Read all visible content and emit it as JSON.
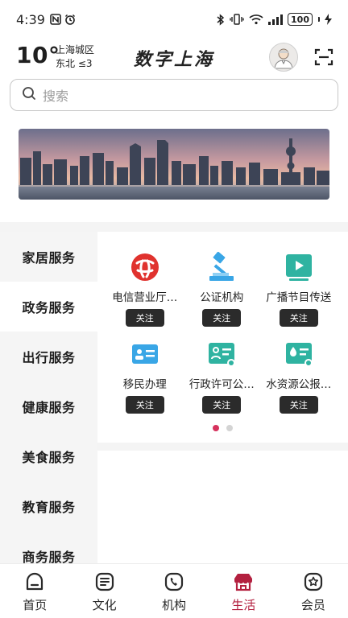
{
  "status_bar": {
    "time": "4:39",
    "battery": "100"
  },
  "header": {
    "temperature": "10°",
    "district": "上海城区",
    "wind": "东北  ≤3",
    "title": "数字上海"
  },
  "search": {
    "placeholder": "搜索"
  },
  "sidebar": {
    "items": [
      {
        "label": "家居服务"
      },
      {
        "label": "政务服务"
      },
      {
        "label": "出行服务"
      },
      {
        "label": "健康服务"
      },
      {
        "label": "美食服务"
      },
      {
        "label": "教育服务"
      },
      {
        "label": "商务服务"
      }
    ],
    "active_index": 1
  },
  "services": [
    {
      "label": "电信营业厅…",
      "icon": "telecom-logo-icon",
      "button": "关注"
    },
    {
      "label": "公证机构",
      "icon": "gavel-icon",
      "button": "关注"
    },
    {
      "label": "广播节目传送",
      "icon": "video-play-icon",
      "button": "关注"
    },
    {
      "label": "移民办理",
      "icon": "id-card-icon",
      "button": "关注"
    },
    {
      "label": "行政许可公…",
      "icon": "license-icon",
      "button": "关注"
    },
    {
      "label": "水资源公报…",
      "icon": "water-report-icon",
      "button": "关注"
    }
  ],
  "pager": {
    "pages": 2,
    "current": 1
  },
  "bottom_nav": {
    "items": [
      {
        "label": "首页",
        "icon": "home-icon"
      },
      {
        "label": "文化",
        "icon": "culture-list-icon"
      },
      {
        "label": "机构",
        "icon": "phone-icon"
      },
      {
        "label": "生活",
        "icon": "life-shop-icon"
      },
      {
        "label": "会员",
        "icon": "member-icon"
      }
    ],
    "active_index": 3
  },
  "colors": {
    "accent": "#b3203f",
    "dot_active": "#d6325d",
    "telecom_red": "#e0322e",
    "blue_icon": "#39a6e6",
    "teal_icon": "#2fb3a1"
  }
}
